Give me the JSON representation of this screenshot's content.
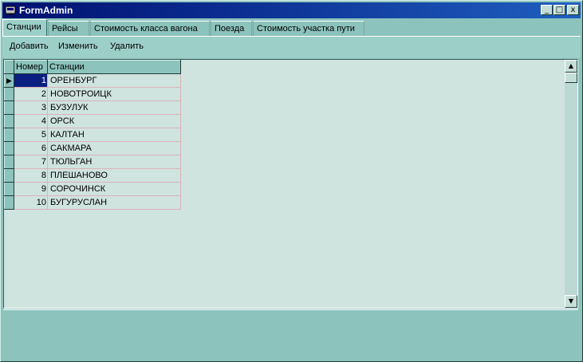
{
  "window": {
    "title": "FormAdmin",
    "controls": {
      "minimize": "_",
      "maximize": "□",
      "close": "x"
    }
  },
  "tabs": [
    {
      "label": "Станции",
      "active": true
    },
    {
      "label": "Рейсы",
      "active": false
    },
    {
      "label": "Стоимость класса вагона",
      "active": false
    },
    {
      "label": "Поезда",
      "active": false
    },
    {
      "label": "Стоимость участка пути",
      "active": false
    }
  ],
  "toolbar": {
    "add_label": "Добавить",
    "edit_label": "Изменить",
    "delete_label": "Удалить"
  },
  "grid": {
    "columns": [
      "Номер",
      "Станции"
    ],
    "rows": [
      [
        "1",
        "ОРЕНБУРГ"
      ],
      [
        "2",
        "НОВОТРОИЦК"
      ],
      [
        "3",
        "БУЗУЛУК"
      ],
      [
        "4",
        "ОРСК"
      ],
      [
        "5",
        "КАЛТАН"
      ],
      [
        "6",
        "САКМАРА"
      ],
      [
        "7",
        "ТЮЛЬГАН"
      ],
      [
        "8",
        "ПЛЕШАНОВО"
      ],
      [
        "9",
        "СОРОЧИНСК"
      ],
      [
        "10",
        "БУГУРУСЛАН"
      ]
    ],
    "selected_row": 0,
    "current_row_marker": "▶"
  },
  "scrollbar": {
    "up": "▲",
    "down": "▼"
  }
}
